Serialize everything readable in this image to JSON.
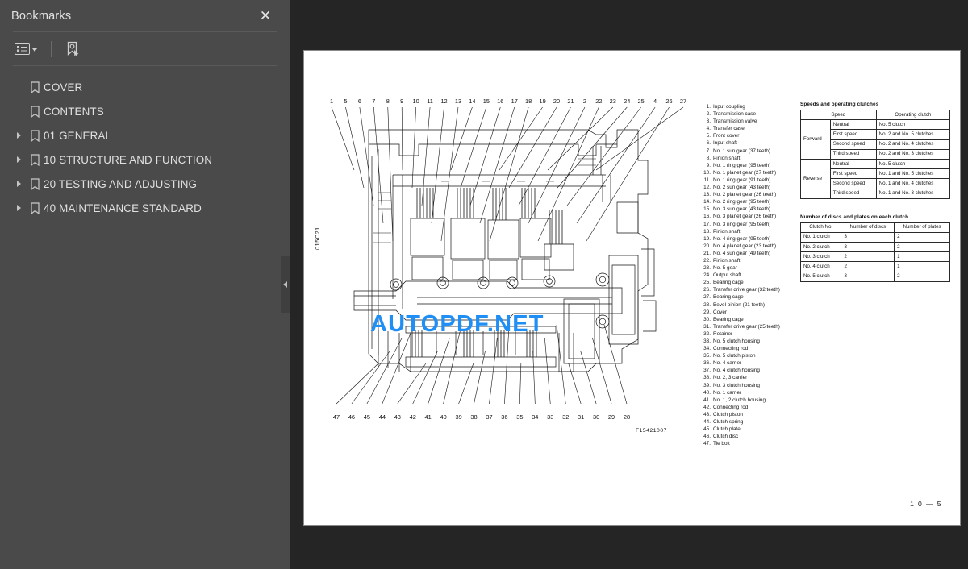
{
  "sidebar": {
    "title": "Bookmarks",
    "close_icon": "close-icon",
    "toolbar": {
      "options_icon": "list-options-icon",
      "caret_icon": "chevron-down-icon",
      "new_bookmark_icon": "new-bookmark-icon"
    },
    "collapse_icon": "collapse-panel-icon",
    "items": [
      {
        "label": "COVER",
        "expandable": false
      },
      {
        "label": "CONTENTS",
        "expandable": false
      },
      {
        "label": "01 GENERAL",
        "expandable": true
      },
      {
        "label": "10 STRUCTURE AND FUNCTION",
        "expandable": true
      },
      {
        "label": "20 TESTING AND ADJUSTING",
        "expandable": true
      },
      {
        "label": "40 MAINTENANCE STANDARD",
        "expandable": true
      }
    ]
  },
  "document": {
    "side_code": "015C21",
    "figure_id": "F15421007",
    "page_number": "1 0 — 5",
    "watermark": "AUTOPDF.NET",
    "watermark_color": "#1f8ff5",
    "callouts_top": [
      "1",
      "5",
      "6",
      "7",
      "8",
      "9",
      "10",
      "11",
      "12",
      "13",
      "14",
      "15",
      "16",
      "17",
      "18",
      "19",
      "20",
      "21",
      "2",
      "22",
      "23",
      "24",
      "25",
      "4",
      "26",
      "27"
    ],
    "callouts_bottom": [
      "47",
      "46",
      "45",
      "44",
      "43",
      "42",
      "41",
      "40",
      "39",
      "38",
      "37",
      "36",
      "35",
      "34",
      "33",
      "32",
      "31",
      "30",
      "29",
      "28"
    ],
    "parts": [
      {
        "n": "1.",
        "name": "Input coupling"
      },
      {
        "n": "2.",
        "name": "Transmission case"
      },
      {
        "n": "3.",
        "name": "Transmission valve"
      },
      {
        "n": "4.",
        "name": "Transfer case"
      },
      {
        "n": "5.",
        "name": "Front cover"
      },
      {
        "n": "6.",
        "name": "Input shaft"
      },
      {
        "n": "7.",
        "name": "No. 1 sun gear (37 teeth)"
      },
      {
        "n": "8.",
        "name": "Pinion shaft"
      },
      {
        "n": "9.",
        "name": "No. 1 ring gear (95 teeth)"
      },
      {
        "n": "10.",
        "name": "No. 1 planet gear (27 teeth)"
      },
      {
        "n": "11.",
        "name": "No. 1 ring gear (91 teeth)"
      },
      {
        "n": "12.",
        "name": "No. 2 sun gear (43 teeth)"
      },
      {
        "n": "13.",
        "name": "No. 2 planet gear (26 teeth)"
      },
      {
        "n": "14.",
        "name": "No. 2 ring gear (95 teeth)"
      },
      {
        "n": "15.",
        "name": "No. 3 sun gear (43 teeth)"
      },
      {
        "n": "16.",
        "name": "No. 3 planet gear (26 teeth)"
      },
      {
        "n": "17.",
        "name": "No. 3 ring gear (95 teeth)"
      },
      {
        "n": "18.",
        "name": "Pinion shaft"
      },
      {
        "n": "19.",
        "name": "No. 4 ring gear (95 teeth)"
      },
      {
        "n": "20.",
        "name": "No. 4 planet gear (23 teeth)"
      },
      {
        "n": "21.",
        "name": "No. 4 sun gear (49 teeth)"
      },
      {
        "n": "22.",
        "name": "Pinion shaft"
      },
      {
        "n": "23.",
        "name": "No. 5 gear"
      },
      {
        "n": "24.",
        "name": "Output shaft"
      },
      {
        "n": "25.",
        "name": "Bearing cage"
      },
      {
        "n": "26.",
        "name": "Transfer drive gear (32 teeth)"
      },
      {
        "n": "27.",
        "name": "Bearing cage"
      },
      {
        "n": "28.",
        "name": "Bevel pinion (21 teeth)"
      },
      {
        "n": "29.",
        "name": "Cover"
      },
      {
        "n": "30.",
        "name": "Bearing cage"
      },
      {
        "n": "31.",
        "name": "Transfer drive gear (25 teeth)"
      },
      {
        "n": "32.",
        "name": "Retainer"
      },
      {
        "n": "33.",
        "name": "No. 5 clutch housing"
      },
      {
        "n": "34.",
        "name": "Connecting rod"
      },
      {
        "n": "35.",
        "name": "No. 5 clutch piston"
      },
      {
        "n": "36.",
        "name": "No. 4 carrier"
      },
      {
        "n": "37.",
        "name": "No. 4 clutch housing"
      },
      {
        "n": "38.",
        "name": "No. 2, 3 carrier"
      },
      {
        "n": "39.",
        "name": "No. 3 clutch housing"
      },
      {
        "n": "40.",
        "name": "No. 1 carrier"
      },
      {
        "n": "41.",
        "name": "No. 1, 2 clutch housing"
      },
      {
        "n": "42.",
        "name": "Connecting rod"
      },
      {
        "n": "43.",
        "name": "Clutch piston"
      },
      {
        "n": "44.",
        "name": "Clutch spring"
      },
      {
        "n": "45.",
        "name": "Clutch plate"
      },
      {
        "n": "46.",
        "name": "Clutch disc"
      },
      {
        "n": "47.",
        "name": "Tie bolt"
      }
    ],
    "table_speeds": {
      "caption": "Speeds and operating clutches",
      "headers": [
        "Speed",
        "Operating clutch"
      ],
      "groups": [
        {
          "direction": "Forward",
          "rows": [
            {
              "speed": "Neutral",
              "clutch": "No. 5 clutch"
            },
            {
              "speed": "First speed",
              "clutch": "No. 2 and No. 5 clutches"
            },
            {
              "speed": "Second speed",
              "clutch": "No. 2 and No. 4 clutches"
            },
            {
              "speed": "Third speed",
              "clutch": "No. 2 and No. 3 clutches"
            }
          ]
        },
        {
          "direction": "Reverse",
          "rows": [
            {
              "speed": "Neutral",
              "clutch": "No. 5 clutch"
            },
            {
              "speed": "First speed",
              "clutch": "No. 1 and No. 5 clutches"
            },
            {
              "speed": "Second speed",
              "clutch": "No. 1 and No. 4 clutches"
            },
            {
              "speed": "Third speed",
              "clutch": "No. 1 and No. 3 clutches"
            }
          ]
        }
      ]
    },
    "table_discs": {
      "caption": "Number of discs and plates on each clutch",
      "headers": [
        "Clutch No.",
        "Number of discs",
        "Number of plates"
      ],
      "rows": [
        {
          "clutch": "No. 1 clutch",
          "discs": "3",
          "plates": "2"
        },
        {
          "clutch": "No. 2 clutch",
          "discs": "3",
          "plates": "2"
        },
        {
          "clutch": "No. 3 clutch",
          "discs": "2",
          "plates": "1"
        },
        {
          "clutch": "No. 4 clutch",
          "discs": "2",
          "plates": "1"
        },
        {
          "clutch": "No. 5 clutch",
          "discs": "3",
          "plates": "2"
        }
      ]
    }
  }
}
